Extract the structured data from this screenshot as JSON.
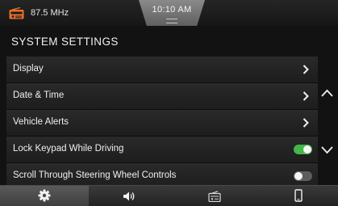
{
  "status": {
    "radio_icon": "radio-icon",
    "radio_frequency": "87.5 MHz",
    "clock": "10:10 AM",
    "accent_color": "#e8712b"
  },
  "header": {
    "title": "SYSTEM SETTINGS"
  },
  "settings": [
    {
      "label": "Display",
      "control": "chevron-right-icon"
    },
    {
      "label": "Date & Time",
      "control": "chevron-right-icon"
    },
    {
      "label": "Vehicle Alerts",
      "control": "chevron-right-icon"
    },
    {
      "label": "Lock Keypad While Driving",
      "control": "toggle",
      "toggle_on": true
    },
    {
      "label": "Scroll Through Steering Wheel Controls",
      "control": "toggle",
      "toggle_on": false
    }
  ],
  "toggle_on_color": "#45b649",
  "scroll": {
    "up_icon": "chevron-up-icon",
    "down_icon": "chevron-down-icon"
  },
  "bottom_nav": [
    {
      "icon": "gear-icon",
      "selected": true
    },
    {
      "icon": "speaker-icon",
      "selected": false
    },
    {
      "icon": "radio-icon",
      "selected": false
    },
    {
      "icon": "phone-icon",
      "selected": false
    }
  ]
}
